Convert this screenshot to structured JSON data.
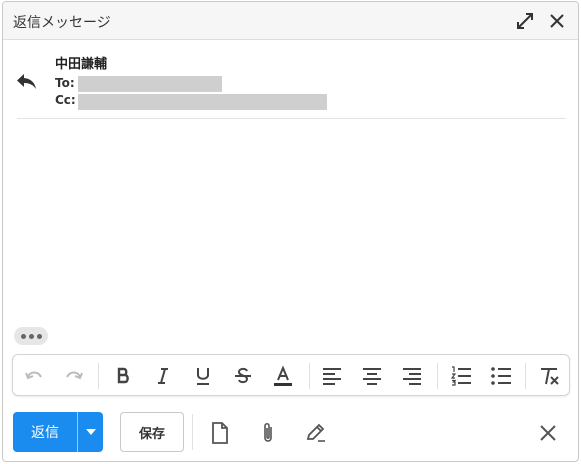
{
  "window": {
    "title": "返信メッセージ"
  },
  "header": {
    "sender_name": "中田謙輔",
    "to_label": "To:",
    "cc_label": "Cc:"
  },
  "editor_toolbar": {
    "buttons": [
      "undo",
      "redo",
      "bold",
      "italic",
      "underline",
      "strikethrough",
      "text-color",
      "align-left",
      "align-center",
      "align-right",
      "ordered-list",
      "unordered-list",
      "clear-formatting"
    ],
    "text_color_underline": "#333333"
  },
  "footer": {
    "send_label": "返信",
    "save_label": "保存"
  },
  "colors": {
    "accent": "#1a8cf0",
    "redacted": "#cfcfcf"
  }
}
